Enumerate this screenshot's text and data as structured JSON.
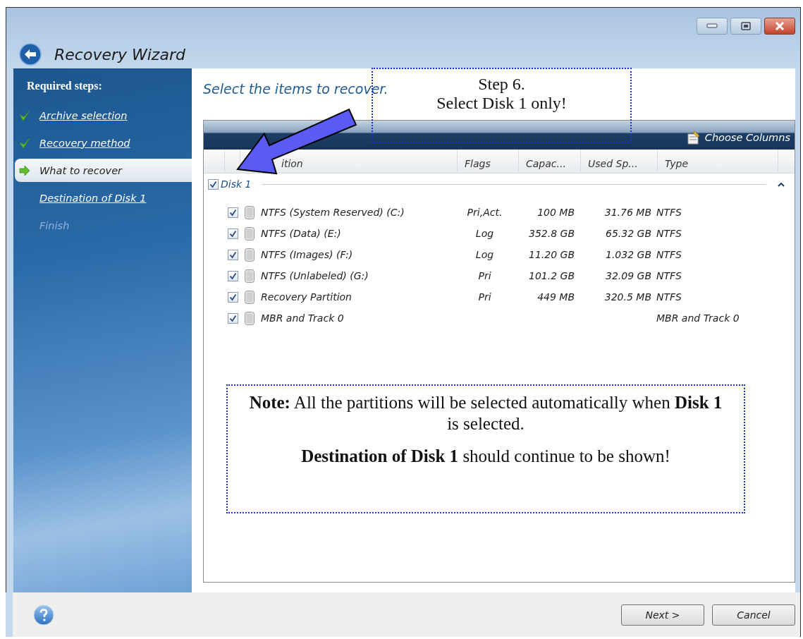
{
  "window": {
    "title": "Recovery Wizard"
  },
  "sidebar": {
    "heading": "Required steps:",
    "steps": [
      {
        "label": "Archive selection",
        "kind": "check",
        "selected": false,
        "disabled": false
      },
      {
        "label": "Recovery method",
        "kind": "check",
        "selected": false,
        "disabled": false
      },
      {
        "label": "What to recover",
        "kind": "arrow",
        "selected": true,
        "disabled": false
      },
      {
        "label": "Destination of Disk 1",
        "kind": "plain",
        "selected": false,
        "disabled": false
      },
      {
        "label": "Finish",
        "kind": "plain",
        "selected": false,
        "disabled": true
      }
    ]
  },
  "content": {
    "heading": "Select the items to recover.",
    "toolbar": {
      "button": "Choose Columns"
    },
    "table": {
      "columns": [
        "ition",
        "Flags",
        "Capac...",
        "Used Sp...",
        "Type"
      ],
      "groups": [
        {
          "label": "Disk 1",
          "checked": true,
          "expanded": true,
          "rows": [
            {
              "name": "NTFS (System Reserved) (C:)",
              "flags": "Pri,Act.",
              "capacity": "100 MB",
              "used": "31.76 MB",
              "type": "NTFS",
              "checked": true
            },
            {
              "name": "NTFS (Data) (E:)",
              "flags": "Log",
              "capacity": "352.8 GB",
              "used": "65.32 GB",
              "type": "NTFS",
              "checked": true
            },
            {
              "name": "NTFS (Images) (F:)",
              "flags": "Log",
              "capacity": "11.20 GB",
              "used": "1.032 GB",
              "type": "NTFS",
              "checked": true
            },
            {
              "name": "NTFS (Unlabeled) (G:)",
              "flags": "Pri",
              "capacity": "101.2 GB",
              "used": "32.09 GB",
              "type": "NTFS",
              "checked": true
            },
            {
              "name": "Recovery Partition",
              "flags": "Pri",
              "capacity": "449 MB",
              "used": "320.5 MB",
              "type": "NTFS",
              "checked": true
            },
            {
              "name": "MBR and Track 0",
              "type": "MBR and Track 0",
              "checked": true
            }
          ]
        }
      ]
    }
  },
  "annotations": [
    {
      "kind": "callout",
      "lines": [
        "Step 6.",
        "Select Disk 1 only!"
      ]
    },
    {
      "kind": "note",
      "paragraphs": [
        "**Note:** All the partitions will be selected automatically when **Disk 1** is selected.",
        "**Destination of Disk 1** should continue to be shown!"
      ]
    }
  ],
  "footer": {
    "buttons": [
      {
        "label": "Next >"
      },
      {
        "label": "Cancel"
      }
    ]
  }
}
